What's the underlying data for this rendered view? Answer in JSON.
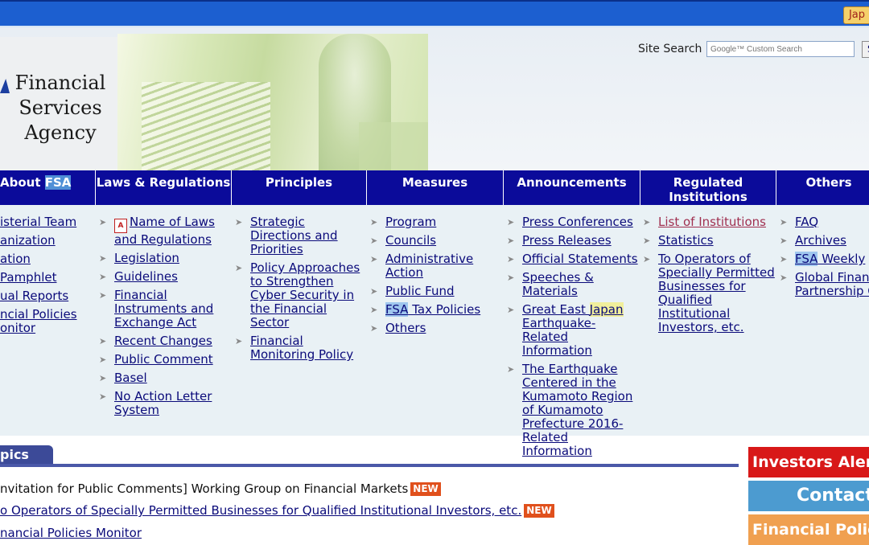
{
  "header": {
    "language_button": "Jap",
    "logo_text": "Financial Services Agency",
    "search_label": "Site Search",
    "search_placeholder": "Google™ Custom Search",
    "search_button": "S"
  },
  "nav": [
    {
      "pre": "About ",
      "hl": "FSA"
    },
    {
      "label": "Laws & Regulations"
    },
    {
      "label": "Principles"
    },
    {
      "label": "Measures"
    },
    {
      "label": "Announcements"
    },
    {
      "label": "Regulated Institutions"
    },
    {
      "label": "Others"
    }
  ],
  "menus": {
    "about": [
      "isterial Team",
      "anization",
      "ation",
      "Pamphlet",
      "ual Reports",
      "ncial Policies onitor"
    ],
    "laws": [
      "Name of Laws and Regulations",
      "Legislation",
      "Guidelines",
      "Financial Instruments and Exchange Act",
      "Recent Changes",
      "Public Comment",
      "Basel",
      "No Action Letter System"
    ],
    "principles": [
      "Strategic Directions and Priorities",
      "Policy Approaches to Strengthen Cyber Security in the Financial Sector",
      "Financial Monitoring Policy"
    ],
    "measures": [
      "Program",
      "Councils",
      "Administrative Action",
      "Public Fund",
      "FSA Tax Policies",
      "Others"
    ],
    "announcements": [
      "Press Conferences",
      "Press Releases",
      "Official Statements",
      "Speeches & Materials",
      "Great East Japan Earthquake-Related Information",
      "The Earthquake Centered in the Kumamoto Region of Kumamoto Prefecture 2016-Related Information"
    ],
    "institutions": [
      "List of Institutions",
      "Statistics",
      "To Operators of Specially Permitted Businesses for Qualified Institutional Investors, etc."
    ],
    "others": [
      "FAQ",
      "Archives",
      "FSA Weekly",
      "Global Financ Partnership C"
    ]
  },
  "topics": {
    "tab_label": "pics",
    "items": [
      {
        "text": "nvitation for Public Comments] Working Group on Financial Markets",
        "new": "NEW"
      },
      {
        "text": "o Operators of Specially Permitted Businesses for Qualified Institutional Investors, etc.",
        "new": "NEW"
      },
      {
        "text": "nancial Policies Monitor",
        "new": ""
      }
    ]
  },
  "banners": [
    "Investors Alert:Cold",
    "Contact us",
    "Financial Policies M"
  ]
}
